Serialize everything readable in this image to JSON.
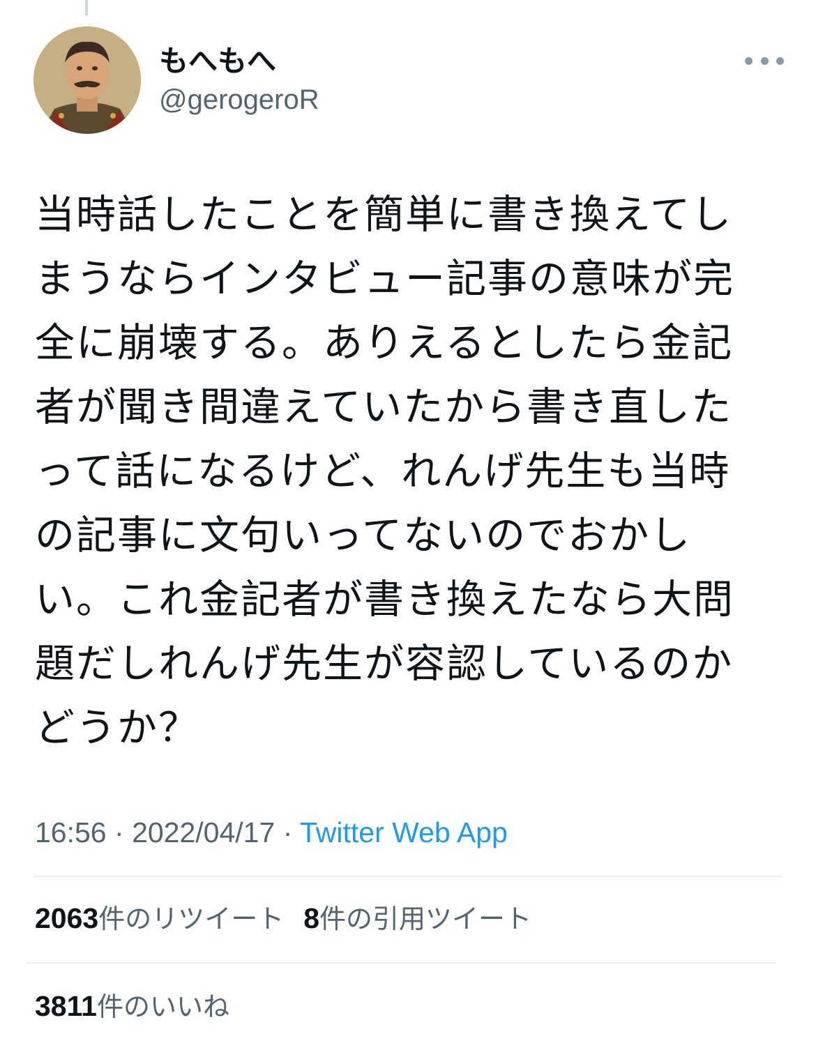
{
  "author": {
    "display_name": "もへもへ",
    "handle": "@gerogeroR"
  },
  "tweet": {
    "text": "当時話したことを簡単に書き換えてし\nまうならインタビュー記事の意味が完\n全に崩壊する。ありえるとしたら金記\n者が聞き間違えていたから書き直した\nって話になるけど、れんげ先生も当時\nの記事に文句いってないのでおかし\nい。これ金記者が書き換えたなら大問\n題だしれんげ先生が容認しているのか\nどうか？",
    "time": "16:56",
    "date": "2022/04/17",
    "separator": "·",
    "source": "Twitter Web App"
  },
  "stats": {
    "retweets_count": "2063",
    "retweets_label": "件のリツイート",
    "quotes_count": "8",
    "quotes_label": "件の引用ツイート",
    "likes_count": "3811",
    "likes_label": "件のいいね"
  },
  "icons": {
    "more": "more-horizontal-icon",
    "avatar": "profile-avatar-image"
  },
  "colors": {
    "link": "#1d9bf0",
    "secondary_text": "#536471",
    "primary_text": "#0f1419",
    "divider": "#e6ecf0"
  }
}
